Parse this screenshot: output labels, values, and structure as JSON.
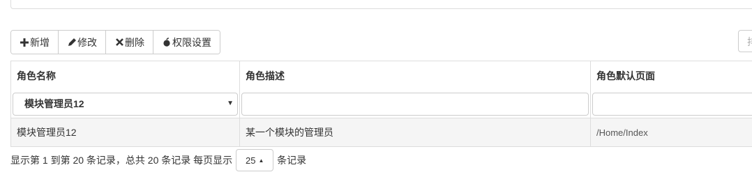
{
  "toolbar": {
    "add_label": "新增",
    "edit_label": "修改",
    "delete_label": "删除",
    "permission_label": "权限设置"
  },
  "right_button": {
    "label": "排"
  },
  "grid": {
    "columns": [
      "角色名称",
      "角色描述",
      "角色默认页面"
    ],
    "filter": {
      "role_name_selected": "模块管理员12",
      "role_desc_value": "",
      "default_page_value": ""
    },
    "rows": [
      {
        "name": "模块管理员12",
        "description": "某一个模块的管理员",
        "default_page": "/Home/Index"
      }
    ]
  },
  "pagination": {
    "summary": "显示第 1 到第 20 条记录，总共 20 条记录 每页显示",
    "page_size": "25",
    "suffix": "条记录"
  },
  "icons": {
    "add": "plus-icon",
    "edit": "pencil-icon",
    "delete": "x-icon",
    "permission": "apple-icon"
  },
  "colors": {
    "border": "#dddddd",
    "row_bg": "#f5f5f5",
    "text": "#333333"
  }
}
